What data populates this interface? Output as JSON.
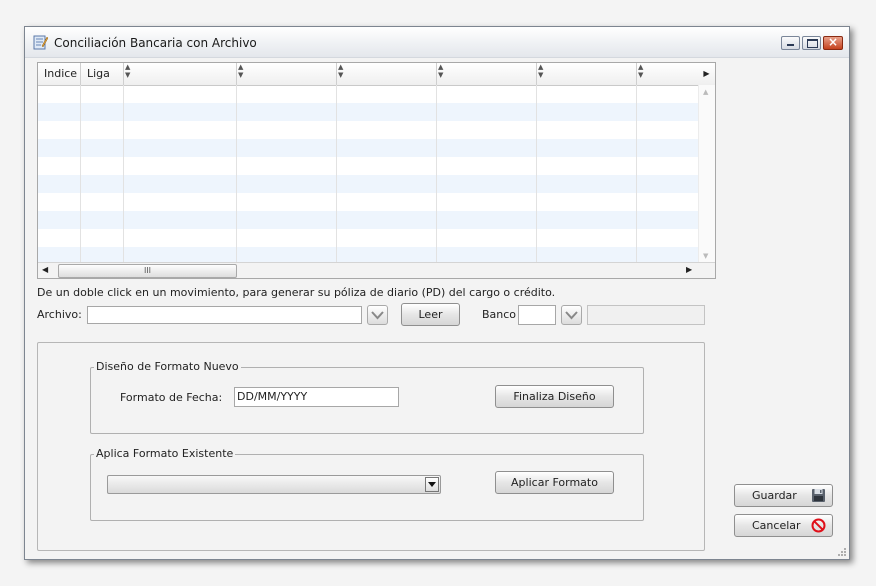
{
  "window": {
    "title": "Conciliación Bancaria con Archivo"
  },
  "grid": {
    "columns": [
      "Indice",
      "Liga",
      "",
      "",
      "",
      "",
      ""
    ],
    "scroll_thumb_glyph": "III"
  },
  "hint": "De un doble click en un movimiento, para generar su póliza de diario (PD) del cargo o crédito.",
  "archivo": {
    "label": "Archivo:",
    "value": ""
  },
  "leer_button": "Leer",
  "banco": {
    "label": "Banco",
    "code": "",
    "name": ""
  },
  "nuevo": {
    "legend": "Diseño de Formato Nuevo",
    "fecha_label": "Formato de Fecha:",
    "fecha_value": "DD/MM/YYYY",
    "finaliza_button": "Finaliza Diseño"
  },
  "existente": {
    "legend": "Aplica Formato Existente",
    "selected": "",
    "aplicar_button": "Aplicar Formato"
  },
  "actions": {
    "guardar": "Guardar",
    "cancelar": "Cancelar"
  },
  "icons": {
    "app": "form-edit-icon",
    "guardar": "floppy-disk-icon",
    "cancelar": "no-entry-icon",
    "dropdown": "chevron-down-icon"
  },
  "colors": {
    "close_button": "#c5421f",
    "row_alt": "#eef5fd",
    "cancel_icon": "#e0101a"
  }
}
